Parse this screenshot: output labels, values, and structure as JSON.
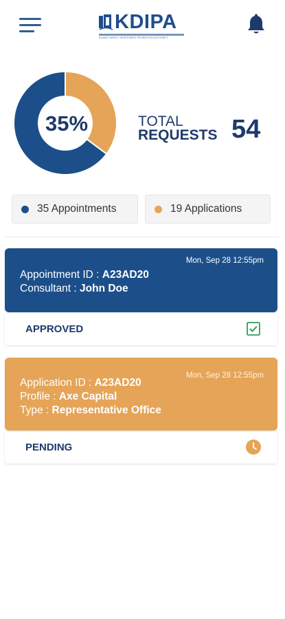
{
  "header": {
    "logo_text": "KDIPA",
    "logo_subtitle": "KUWAIT DIRECT INVESTMENT PROMOTION AUTHORITY",
    "menu_icon": "hamburger-menu-icon",
    "notification_icon": "bell-icon"
  },
  "summary": {
    "percent_label": "35%",
    "total_label_line1": "TOTAL",
    "total_label_line2": "REQUESTS",
    "total_count": "54"
  },
  "chart_data": {
    "type": "pie",
    "categories": [
      "Appointments",
      "Applications"
    ],
    "values": [
      35,
      19
    ],
    "colors": [
      "#1c4f8a",
      "#e5a457"
    ]
  },
  "legend": [
    {
      "label": "35 Appointments",
      "color": "#1c4f8a"
    },
    {
      "label": "19 Applications",
      "color": "#e5a457"
    }
  ],
  "cards": [
    {
      "date": "Mon, Sep 28 12:55pm",
      "lines": [
        {
          "label": "Appointment ID : ",
          "value": "A23AD20"
        },
        {
          "label": "Consultant : ",
          "value": "John Doe"
        }
      ],
      "status": "APPROVED",
      "status_icon": "checkbox-checked-icon",
      "color": "#1c4f8a"
    },
    {
      "date": "Mon, Sep 28 12:55pm",
      "lines": [
        {
          "label": "Application ID : ",
          "value": "A23AD20"
        },
        {
          "label": "Profile : ",
          "value": "Axe Capital"
        },
        {
          "label": "Type : ",
          "value": "Representative Office"
        }
      ],
      "status": "PENDING",
      "status_icon": "clock-icon",
      "color": "#e5a457"
    }
  ]
}
